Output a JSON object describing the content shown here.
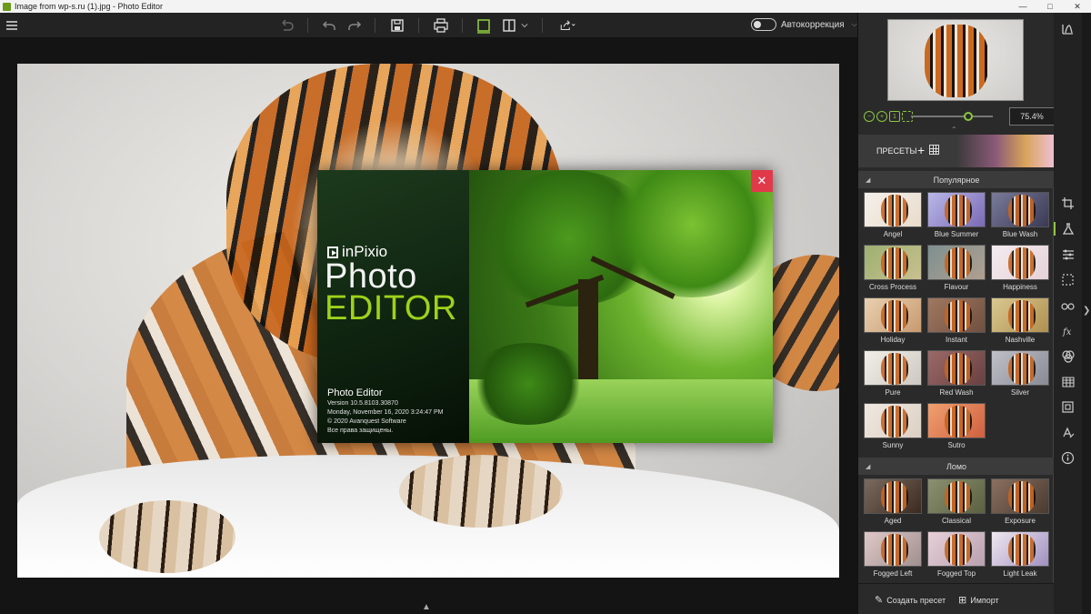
{
  "window": {
    "title": "Image from wp-s.ru (1).jpg - Photo Editor",
    "minimize": "—",
    "maximize": "□",
    "close": "✕"
  },
  "toolbar": {
    "menu_icon": "hamburger-menu-icon",
    "autocorrect_label": "Автокоррекция",
    "autocorrect_on": false,
    "accent": "#8cc63f"
  },
  "splash": {
    "brand": "inPixio",
    "word1": "Photo",
    "word2": "EDITOR",
    "product_name": "Photo Editor",
    "version": "Version 10.5.8103.30870",
    "build_date": "Monday, November 16, 2020 3:24:47 PM",
    "copyright": "© 2020 Avanquest Software",
    "rights": "Все права защищены.",
    "close_glyph": "✕",
    "close_color": "#e0394a",
    "brand_accent": "#9dd21b"
  },
  "navigator": {
    "zoom_value": "75.4%",
    "zoom_fraction": 0.754
  },
  "presets": {
    "title": "ПРЕСЕТЫ",
    "add_glyph": "+",
    "categories": [
      {
        "name": "Популярное",
        "items": [
          "Angel",
          "Blue Summer",
          "Blue Wash",
          "Cross Process",
          "Flavour",
          "Happiness",
          "Holiday",
          "Instant",
          "Nashville",
          "Pure",
          "Red Wash",
          "Silver",
          "Sunny",
          "Sutro"
        ]
      },
      {
        "name": "Ломо",
        "items": [
          "Aged",
          "Classical",
          "Exposure",
          "Fogged Left",
          "Fogged Top",
          "Light Leak"
        ]
      }
    ],
    "create_label": "Создать пресет",
    "import_label": "Импорт"
  },
  "side_tools": [
    "histogram-icon",
    "crop-icon",
    "filters-flask-icon",
    "adjustments-sliders-icon",
    "selection-icon",
    "glasses-icon",
    "fx-icon",
    "blend-icon",
    "texture-icon",
    "frame-icon",
    "text-icon",
    "info-icon"
  ]
}
